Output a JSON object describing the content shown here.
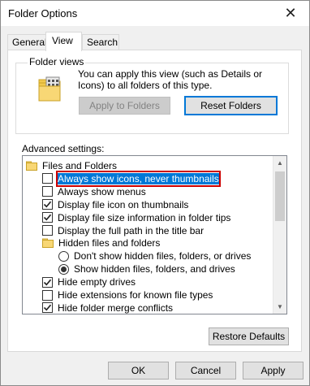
{
  "window": {
    "title": "Folder Options",
    "close_glyph": "✕"
  },
  "tabs": [
    {
      "label": "General",
      "active": false
    },
    {
      "label": "View",
      "active": true
    },
    {
      "label": "Search",
      "active": false
    }
  ],
  "folder_views": {
    "legend": "Folder views",
    "description": "You can apply this view (such as Details or Icons) to all folders of this type.",
    "apply_button": "Apply to Folders",
    "reset_button": "Reset Folders"
  },
  "advanced": {
    "label": "Advanced settings:",
    "items": [
      {
        "type": "folder",
        "label": "Files and Folders",
        "indent": 0
      },
      {
        "type": "checkbox",
        "label": "Always show icons, never thumbnails",
        "checked": false,
        "selected": true,
        "indent": 1
      },
      {
        "type": "checkbox",
        "label": "Always show menus",
        "checked": false,
        "indent": 1
      },
      {
        "type": "checkbox",
        "label": "Display file icon on thumbnails",
        "checked": true,
        "indent": 1
      },
      {
        "type": "checkbox",
        "label": "Display file size information in folder tips",
        "checked": true,
        "indent": 1
      },
      {
        "type": "checkbox",
        "label": "Display the full path in the title bar",
        "checked": false,
        "indent": 1
      },
      {
        "type": "folder",
        "label": "Hidden files and folders",
        "indent": 1
      },
      {
        "type": "radio",
        "label": "Don't show hidden files, folders, or drives",
        "checked": false,
        "indent": 2
      },
      {
        "type": "radio",
        "label": "Show hidden files, folders, and drives",
        "checked": true,
        "indent": 2
      },
      {
        "type": "checkbox",
        "label": "Hide empty drives",
        "checked": true,
        "indent": 1
      },
      {
        "type": "checkbox",
        "label": "Hide extensions for known file types",
        "checked": false,
        "indent": 1
      },
      {
        "type": "checkbox",
        "label": "Hide folder merge conflicts",
        "checked": true,
        "indent": 1
      }
    ],
    "restore_button": "Restore Defaults"
  },
  "footer": {
    "ok": "OK",
    "cancel": "Cancel",
    "apply": "Apply"
  },
  "colors": {
    "selection": "#0078d7",
    "annotation": "#cc0000",
    "folder": "#f8d775"
  }
}
